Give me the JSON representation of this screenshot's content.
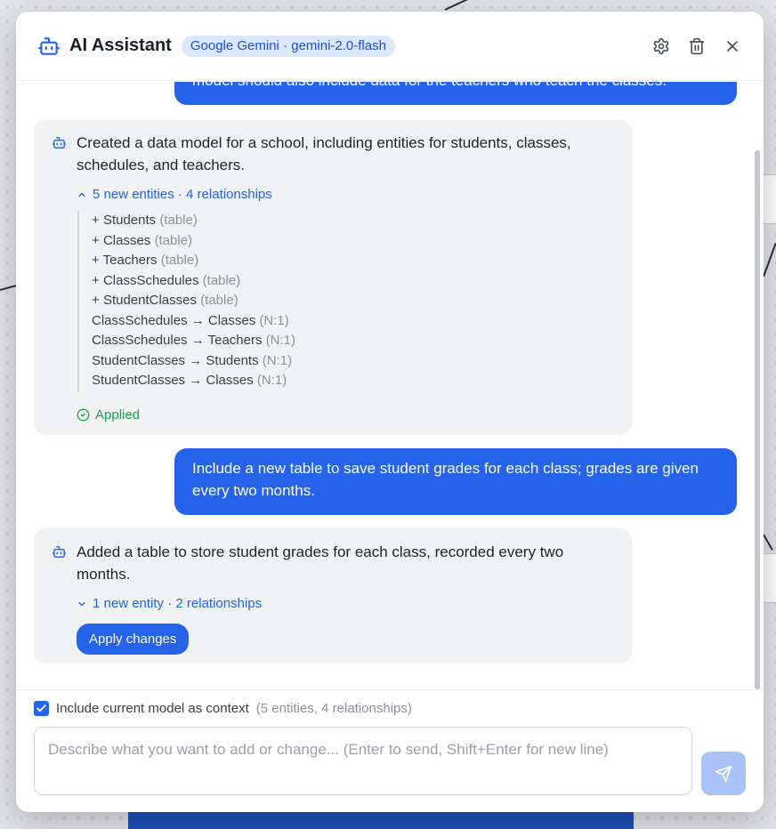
{
  "header": {
    "title": "AI Assistant",
    "model_badge": "Google Gemini · gemini-2.0-flash",
    "settings_icon": "gear-icon",
    "delete_icon": "trash-icon",
    "close_icon": "close-icon"
  },
  "messages": [
    {
      "role": "user",
      "text": "model should also include data for the teachers who teach the classes."
    },
    {
      "role": "assistant",
      "text": "Created a data model for a school, including entities for students, classes, schedules, and teachers.",
      "summary": "5 new entities · 4 relationships",
      "expanded": true,
      "entities": [
        {
          "prefix": "+ ",
          "name": "Students",
          "kind": "(table)"
        },
        {
          "prefix": "+ ",
          "name": "Classes",
          "kind": "(table)"
        },
        {
          "prefix": "+ ",
          "name": "Teachers",
          "kind": "(table)"
        },
        {
          "prefix": "+ ",
          "name": "ClassSchedules",
          "kind": "(table)"
        },
        {
          "prefix": "+ ",
          "name": "StudentClasses",
          "kind": "(table)"
        }
      ],
      "relationships": [
        {
          "text": "ClassSchedules → Classes",
          "card": "(N:1)"
        },
        {
          "text": "ClassSchedules → Teachers",
          "card": "(N:1)"
        },
        {
          "text": "StudentClasses → Students",
          "card": "(N:1)"
        },
        {
          "text": "StudentClasses → Classes",
          "card": "(N:1)"
        }
      ],
      "status": "Applied"
    },
    {
      "role": "user",
      "text": "Include a new table to save student grades for each class; grades are given every two months."
    },
    {
      "role": "assistant",
      "text": "Added a table to store student grades for each class, recorded every two months.",
      "summary": "1 new entity · 2 relationships",
      "expanded": false,
      "action": "Apply changes"
    }
  ],
  "footer": {
    "context_checked": true,
    "context_label": "Include current model as context",
    "context_count": "(5 entities, 4 relationships)",
    "input_placeholder": "Describe what you want to add or change... (Enter to send, Shift+Enter for new line)",
    "input_value": ""
  },
  "colors": {
    "accent": "#2563eb",
    "badge_bg": "#dbe7fd",
    "success": "#16a34a",
    "send_disabled": "#a9c3f9"
  }
}
